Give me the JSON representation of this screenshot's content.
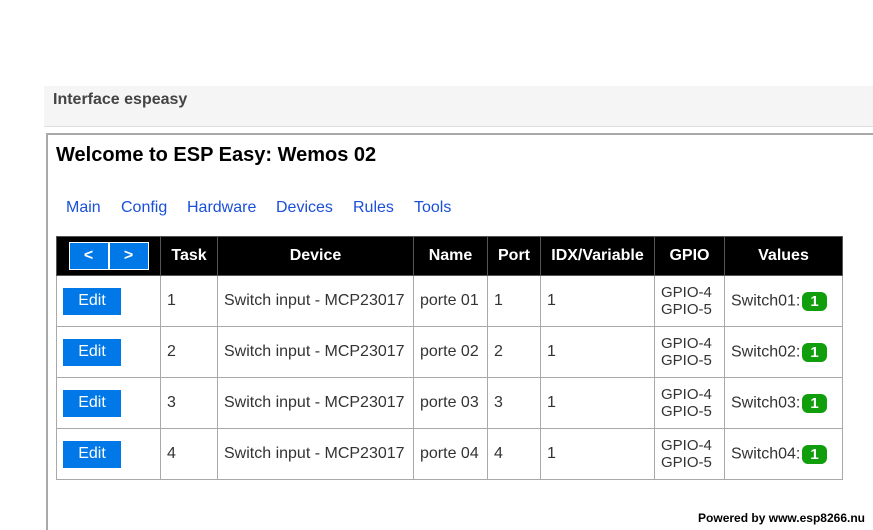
{
  "header": {
    "title": "Interface espeasy"
  },
  "page": {
    "title": "Welcome to ESP Easy: Wemos 02"
  },
  "menu": {
    "items": [
      {
        "label": "Main"
      },
      {
        "label": "Config"
      },
      {
        "label": "Hardware"
      },
      {
        "label": "Devices"
      },
      {
        "label": "Rules"
      },
      {
        "label": "Tools"
      }
    ]
  },
  "table": {
    "nav": {
      "prev": "<",
      "next": ">"
    },
    "columns": [
      "Task",
      "Device",
      "Name",
      "Port",
      "IDX/Variable",
      "GPIO",
      "Values"
    ],
    "edit_label": "Edit",
    "rows": [
      {
        "task": "1",
        "device": "Switch input - MCP23017",
        "name": "porte 01",
        "port": "1",
        "idx": "1",
        "gpio1": "GPIO-4",
        "gpio2": "GPIO-5",
        "value_label": "Switch01:",
        "value": "1"
      },
      {
        "task": "2",
        "device": "Switch input - MCP23017",
        "name": "porte 02",
        "port": "2",
        "idx": "1",
        "gpio1": "GPIO-4",
        "gpio2": "GPIO-5",
        "value_label": "Switch02:",
        "value": "1"
      },
      {
        "task": "3",
        "device": "Switch input - MCP23017",
        "name": "porte 03",
        "port": "3",
        "idx": "1",
        "gpio1": "GPIO-4",
        "gpio2": "GPIO-5",
        "value_label": "Switch03:",
        "value": "1"
      },
      {
        "task": "4",
        "device": "Switch input - MCP23017",
        "name": "porte 04",
        "port": "4",
        "idx": "1",
        "gpio1": "GPIO-4",
        "gpio2": "GPIO-5",
        "value_label": "Switch04:",
        "value": "1"
      }
    ]
  },
  "footer": {
    "text": "Powered by www.esp8266.nu"
  },
  "colors": {
    "accent": "#0078e7",
    "badge": "#119e0c",
    "link": "#1a4fd8"
  }
}
